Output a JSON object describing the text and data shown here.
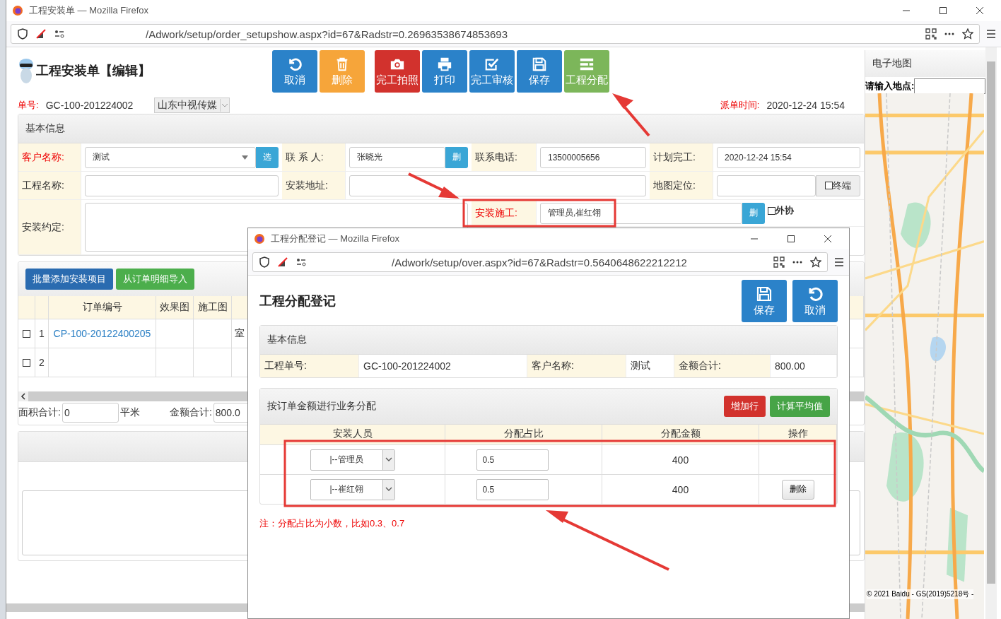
{
  "main_window": {
    "title": "工程安装单 — Mozilla Firefox",
    "url": "/Adwork/setup/order_setupshow.aspx?id=67&Radstr=0.26963538674853693"
  },
  "header": {
    "title": "工程安装单【编辑】",
    "order_label": "单号:",
    "order_no": "GC-100-201224002",
    "company": "山东中视传媒",
    "dispatch_label": "派单时间:",
    "dispatch_time": "2020-12-24 15:54"
  },
  "toolbar": [
    {
      "label": "取消",
      "color": "#2b82c9"
    },
    {
      "label": "删除",
      "color": "#f6a53a"
    },
    {
      "label": "完工拍照",
      "color": "#d2322d"
    },
    {
      "label": "打印",
      "color": "#2b82c9"
    },
    {
      "label": "完工审核",
      "color": "#2b82c9"
    },
    {
      "label": "保存",
      "color": "#2b82c9"
    },
    {
      "label": "工程分配",
      "color": "#7cb65a"
    }
  ],
  "basic_info": {
    "title": "基本信息",
    "fields": [
      {
        "label": "客户名称:",
        "required": true,
        "kind": "select",
        "value": "测试",
        "button": "选"
      },
      {
        "label": "联 系 人:",
        "required": false,
        "kind": "text",
        "value": "张晓光",
        "button": "删"
      },
      {
        "label": "联系电话:",
        "required": false,
        "kind": "text",
        "value": "13500005656"
      },
      {
        "label": "计划完工:",
        "required": false,
        "kind": "text",
        "value": "2020-12-24 15:54"
      },
      {
        "label": "工程名称:",
        "required": false,
        "kind": "text"
      },
      {
        "label": "安装地址:",
        "required": false,
        "kind": "text"
      },
      {
        "label": "地图定位:",
        "required": false,
        "kind": "text",
        "checkbox": {
          "kind": "addon",
          "label": "终端",
          "checked": false
        }
      },
      {
        "label": "安装约定:",
        "required": false,
        "kind": "textarea"
      },
      {
        "label": "安装施工:",
        "required": true,
        "kind": "text",
        "value": "管理员,崔红翎",
        "button": "删",
        "checkbox": {
          "kind": "outside",
          "label": "外协",
          "checked": false
        }
      }
    ]
  },
  "items": {
    "buttons": [
      {
        "label": "批量添加安装项目",
        "color": "#2a6bb0"
      },
      {
        "label": "从订单明细导入",
        "color": "#4cae4c"
      }
    ],
    "columns": [
      "",
      "",
      "订单编号",
      "效果图",
      "施工图",
      ""
    ],
    "rows": [
      {
        "checked": false,
        "index": "1",
        "order_no": "CP-100-20122400205",
        "column_6": "室"
      },
      {
        "checked": false,
        "index": "2"
      }
    ],
    "area_label": "面积合计:",
    "area": "0",
    "area_unit": "平米",
    "amount_label": "金额合计:",
    "amount": "800.0"
  },
  "map": {
    "title": "电子地图",
    "search_label": "请输入地点:",
    "copyright": "© 2021 Baidu - GS(2019)5218号 -"
  },
  "popup": {
    "window_title": "工程分配登记 — Mozilla Firefox",
    "url": "/Adwork/setup/over.aspx?id=67&Radstr=0.5640648622212212",
    "title": "工程分配登记",
    "buttons": [
      {
        "label": "保存"
      },
      {
        "label": "取消"
      }
    ],
    "info_title": "基本信息",
    "info": [
      {
        "label": "工程单号:",
        "value": "GC-100-201224002"
      },
      {
        "label": "客户名称:",
        "value": "测试"
      },
      {
        "label": "金额合计:",
        "value": "800.00"
      }
    ],
    "section_title": "按订单金额进行业务分配",
    "section_buttons": [
      {
        "label": "增加行",
        "color": "#d2322d"
      },
      {
        "label": "计算平均值",
        "color": "#47a447"
      }
    ],
    "columns": [
      "安装人员",
      "分配占比",
      "分配金额",
      "操作"
    ],
    "rows": [
      {
        "person": "|--管理员",
        "ratio": "0.5",
        "amount": "400"
      },
      {
        "person": "|--崔红翎",
        "ratio": "0.5",
        "amount": "400",
        "action": "删除"
      }
    ],
    "note": "注：分配占比为小数，比如0.3、0.7"
  }
}
